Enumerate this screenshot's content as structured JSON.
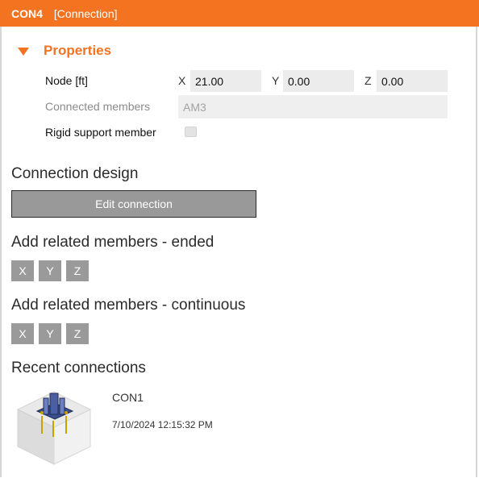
{
  "titlebar": {
    "name": "CON4",
    "type": "[Connection]"
  },
  "properties": {
    "title": "Properties",
    "node_label": "Node [ft]",
    "x_axis": "X",
    "x_value": "21.00",
    "y_axis": "Y",
    "y_value": "0.00",
    "z_axis": "Z",
    "z_value": "0.00",
    "connected_label": "Connected members",
    "connected_value": "AM3",
    "rigid_label": "Rigid support member"
  },
  "design": {
    "heading": "Connection design",
    "button": "Edit connection"
  },
  "ended": {
    "heading": "Add related members - ended",
    "x": "X",
    "y": "Y",
    "z": "Z"
  },
  "continuous": {
    "heading": "Add related members - continuous",
    "x": "X",
    "y": "Y",
    "z": "Z"
  },
  "recent": {
    "heading": "Recent connections",
    "items": [
      {
        "name": "CON1",
        "date": "7/10/2024 12:15:32 PM",
        "icon": "connection-thumbnail"
      }
    ]
  },
  "colors": {
    "accent": "#f37321",
    "button_gray": "#9a9a9a",
    "field_bg": "#ececec"
  }
}
